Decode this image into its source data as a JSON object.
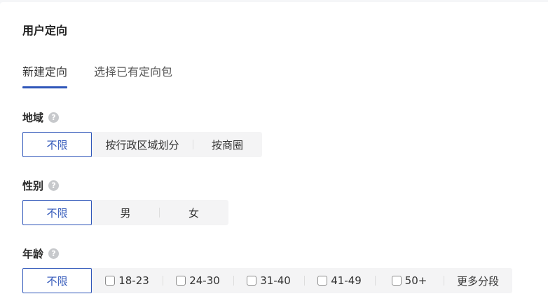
{
  "section": {
    "title": "用户定向"
  },
  "tabs": [
    {
      "label": "新建定向",
      "active": true
    },
    {
      "label": "选择已有定向包",
      "active": false
    }
  ],
  "region": {
    "label": "地域",
    "help_icon": "question-circle-icon",
    "options": [
      {
        "label": "不限",
        "selected": true
      },
      {
        "label": "按行政区域划分",
        "selected": false
      },
      {
        "label": "按商圈",
        "selected": false
      }
    ]
  },
  "gender": {
    "label": "性别",
    "help_icon": "question-circle-icon",
    "options": [
      {
        "label": "不限",
        "selected": true
      },
      {
        "label": "男",
        "selected": false
      },
      {
        "label": "女",
        "selected": false
      }
    ]
  },
  "age": {
    "label": "年龄",
    "help_icon": "question-circle-icon",
    "unlimited_label": "不限",
    "ranges": [
      {
        "label": "18-23",
        "checked": false
      },
      {
        "label": "24-30",
        "checked": false
      },
      {
        "label": "31-40",
        "checked": false
      },
      {
        "label": "41-49",
        "checked": false
      },
      {
        "label": "50+",
        "checked": false
      }
    ],
    "more_label": "更多分段"
  },
  "colors": {
    "accent": "#2f56b9",
    "segment_bg": "#f4f4f5",
    "help_icon_bg": "#c7c9cc"
  }
}
